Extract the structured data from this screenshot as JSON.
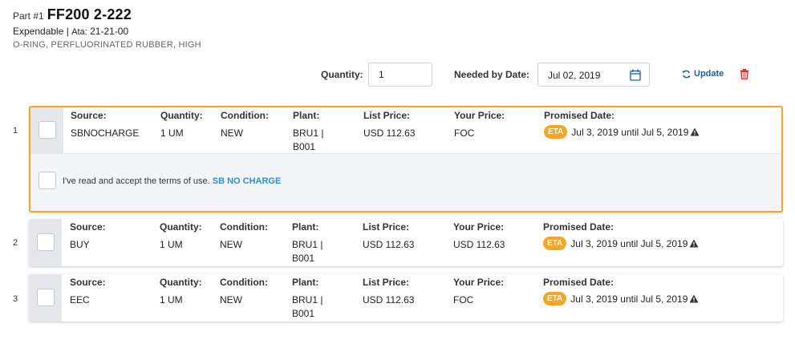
{
  "part": {
    "prefix": "Part #1",
    "number": "FF200 2-222",
    "type": "Expendable |",
    "ata_label": "Ata:",
    "ata_value": "21-21-00",
    "description": "O-RING, PERFLUORINATED RUBBER, HIGH"
  },
  "controls": {
    "quantity_label": "Quantity:",
    "quantity_value": "1",
    "needed_by_label": "Needed by Date:",
    "needed_by_value": "Jul 02, 2019",
    "update_label": "Update"
  },
  "columns": {
    "source": "Source:",
    "quantity": "Quantity:",
    "condition": "Condition:",
    "plant": "Plant:",
    "list_price": "List Price:",
    "your_price": "Your Price:",
    "promised_date": "Promised Date:"
  },
  "offers": [
    {
      "index": "1",
      "source": "SBNOCHARGE",
      "quantity": "1 UM",
      "condition": "NEW",
      "plant_line1": "BRU1 |",
      "plant_line2": "B001",
      "list_price": "USD 112.63",
      "your_price": "FOC",
      "eta_badge": "ETA",
      "promised": "Jul 3, 2019 until Jul 5, 2019",
      "terms_text": "I've read and accept the terms of use.",
      "terms_link": "SB NO CHARGE"
    },
    {
      "index": "2",
      "source": "BUY",
      "quantity": "1 UM",
      "condition": "NEW",
      "plant_line1": "BRU1 |",
      "plant_line2": "B001",
      "list_price": "USD 112.63",
      "your_price": "USD 112.63",
      "eta_badge": "ETA",
      "promised": "Jul 3, 2019 until Jul 5, 2019"
    },
    {
      "index": "3",
      "source": "EEC",
      "quantity": "1 UM",
      "condition": "NEW",
      "plant_line1": "BRU1 |",
      "plant_line2": "B001",
      "list_price": "USD 112.63",
      "your_price": "FOC",
      "eta_badge": "ETA",
      "promised": "Jul 3, 2019 until Jul 5, 2019"
    }
  ],
  "colors": {
    "accent_orange": "#f5a623",
    "link_blue": "#2b8fd6",
    "update_blue": "#1f5fa8",
    "delete_red": "#d9302c"
  },
  "icons": {
    "calendar": "calendar-icon",
    "refresh": "refresh-icon",
    "delete": "trash-icon",
    "warning": "warning-icon"
  }
}
